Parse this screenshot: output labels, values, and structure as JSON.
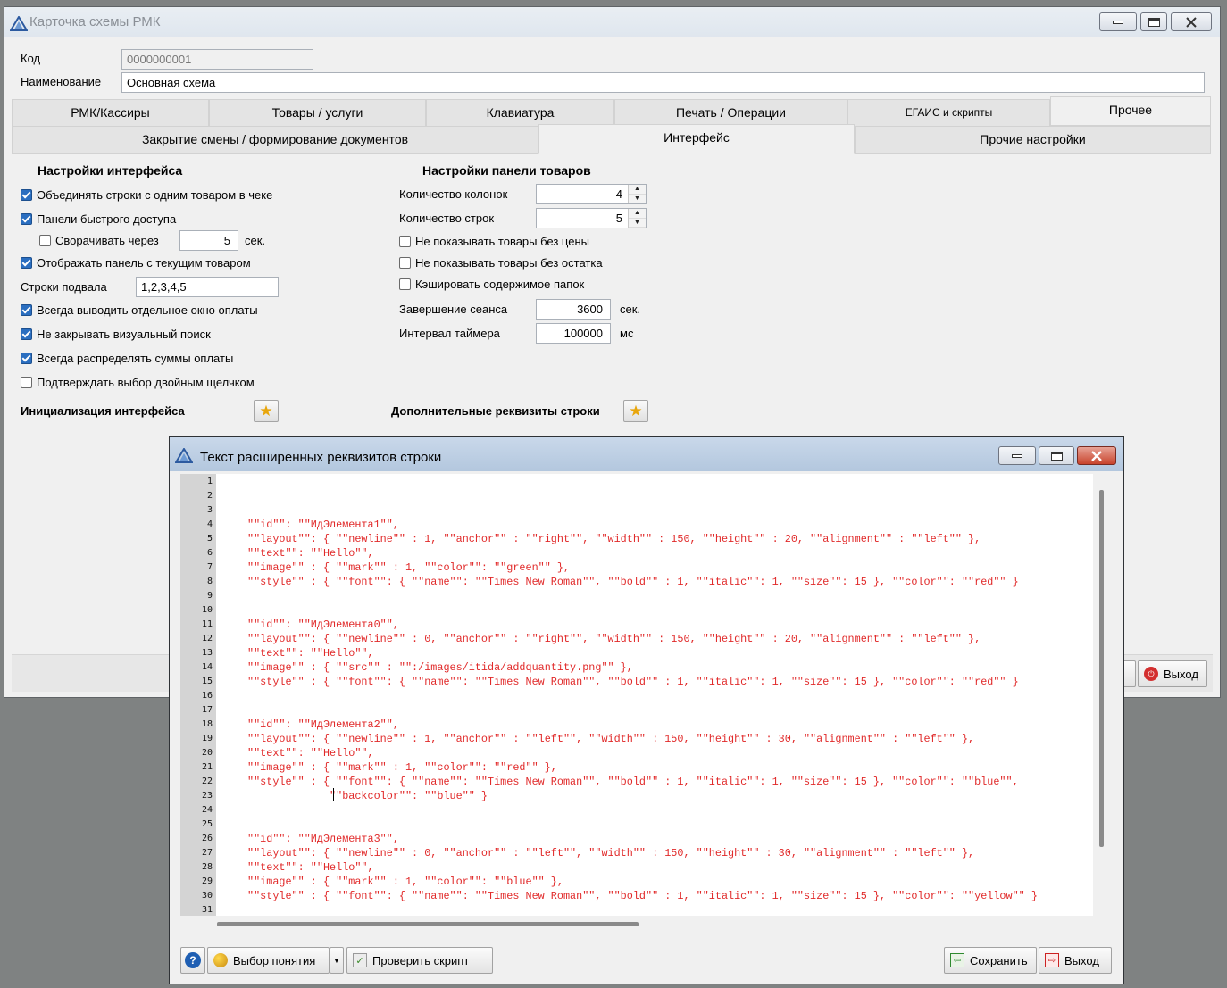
{
  "main_window": {
    "title": "Карточка схемы РМК",
    "code_label": "Код",
    "code_value": "0000000001",
    "name_label": "Наименование",
    "name_value": "Основная схема",
    "tabs_row1": [
      "РМК/Кассиры",
      "Товары / услуги",
      "Клавиатура",
      "Печать / Операции",
      "ЕГАИС и скрипты",
      "Прочее"
    ],
    "tabs_row2": [
      "Закрытие смены / формирование документов",
      "Интерфейс",
      "Прочие настройки"
    ],
    "left": {
      "heading": "Настройки интерфейса",
      "merge_rows": "Объединять строки с одним товаром в чеке",
      "quick_panels": "Панели быстрого доступа",
      "collapse_after": "Сворачивать через",
      "collapse_value": "5",
      "collapse_unit": "сек.",
      "show_current": "Отображать панель с текущим товаром",
      "footer_lines_label": "Строки подвала",
      "footer_lines_value": "1,2,3,4,5",
      "payment_window": "Всегда выводить отдельное окно оплаты",
      "no_close_search": "Не закрывать визуальный поиск",
      "distribute_sums": "Всегда распределять суммы оплаты",
      "confirm_dblclick": "Подтверждать выбор двойным щелчком",
      "init_label": "Инициализация интерфейса"
    },
    "right": {
      "heading": "Настройки панели товаров",
      "cols_label": "Количество колонок",
      "cols_value": "4",
      "rows_label": "Количество строк",
      "rows_value": "5",
      "hide_no_price": "Не показывать товары без цены",
      "hide_no_stock": "Не показывать товары без остатка",
      "cache_folders": "Кэшировать содержимое папок",
      "session_end_label": "Завершение сеанса",
      "session_end_value": "3600",
      "session_end_unit": "сек.",
      "timer_label": "Интервал таймера",
      "timer_value": "100000",
      "timer_unit": "мс",
      "extra_label": "Дополнительные реквизиты строки"
    },
    "exit_button": "Выход"
  },
  "dialog": {
    "title": "Текст расширенных реквизитов строки",
    "lines": [
      "",
      "",
      "",
      "\"\"id\"\": \"\"ИдЭлемента1\"\",",
      "\"\"layout\"\": { \"\"newline\"\" : 1, \"\"anchor\"\" : \"\"right\"\", \"\"width\"\" : 150, \"\"height\"\" : 20, \"\"alignment\"\" : \"\"left\"\" },",
      "\"\"text\"\": \"\"Hello\"\",",
      "\"\"image\"\" : { \"\"mark\"\" : 1, \"\"color\"\": \"\"green\"\" },",
      "\"\"style\"\" : { \"\"font\"\": { \"\"name\"\": \"\"Times New Roman\"\", \"\"bold\"\" : 1, \"\"italic\"\": 1, \"\"size\"\": 15 }, \"\"color\"\": \"\"red\"\" }",
      "",
      "",
      "\"\"id\"\": \"\"ИдЭлемента0\"\",",
      "\"\"layout\"\": { \"\"newline\"\" : 0, \"\"anchor\"\" : \"\"right\"\", \"\"width\"\" : 150, \"\"height\"\" : 20, \"\"alignment\"\" : \"\"left\"\" },",
      "\"\"text\"\": \"\"Hello\"\",",
      "\"\"image\"\" : { \"\"src\"\" : \"\":/images/itida/addquantity.png\"\" },",
      "\"\"style\"\" : { \"\"font\"\": { \"\"name\"\": \"\"Times New Roman\"\", \"\"bold\"\" : 1, \"\"italic\"\": 1, \"\"size\"\": 15 }, \"\"color\"\": \"\"red\"\" }",
      "",
      "",
      "\"\"id\"\": \"\"ИдЭлемента2\"\",",
      "\"\"layout\"\": { \"\"newline\"\" : 1, \"\"anchor\"\" : \"\"left\"\", \"\"width\"\" : 150, \"\"height\"\" : 30, \"\"alignment\"\" : \"\"left\"\" },",
      "\"\"text\"\": \"\"Hello\"\",",
      "\"\"image\"\" : { \"\"mark\"\" : 1, \"\"color\"\": \"\"red\"\" },",
      "\"\"style\"\" : { \"\"font\"\": { \"\"name\"\": \"\"Times New Roman\"\", \"\"bold\"\" : 1, \"\"italic\"\": 1, \"\"size\"\": 15 }, \"\"color\"\": \"\"blue\"\",",
      "             \"\"backcolor\"\": \"\"blue\"\" }",
      "",
      "",
      "\"\"id\"\": \"\"ИдЭлемента3\"\",",
      "\"\"layout\"\": { \"\"newline\"\" : 0, \"\"anchor\"\" : \"\"left\"\", \"\"width\"\" : 150, \"\"height\"\" : 30, \"\"alignment\"\" : \"\"left\"\" },",
      "\"\"text\"\": \"\"Hello\"\",",
      "\"\"image\"\" : { \"\"mark\"\" : 1, \"\"color\"\": \"\"blue\"\" },",
      "\"\"style\"\" : { \"\"font\"\": { \"\"name\"\": \"\"Times New Roman\"\", \"\"bold\"\" : 1, \"\"italic\"\": 1, \"\"size\"\": 15 }, \"\"color\"\": \"\"yellow\"\" }",
      ""
    ],
    "help_button": "?",
    "concept_button": "Выбор понятия",
    "check_button": "Проверить скрипт",
    "save_button": "Сохранить",
    "exit_button": "Выход"
  }
}
